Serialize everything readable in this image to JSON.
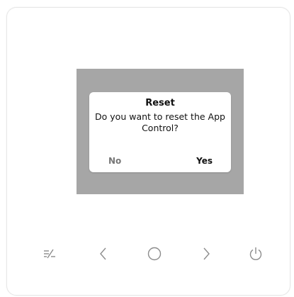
{
  "dialog": {
    "title": "Reset",
    "message": "Do you want to reset the App Control?",
    "no_label": "No",
    "yes_label": "Yes"
  },
  "buttons": [
    {
      "icon": "edit-menu-icon"
    },
    {
      "icon": "chevron-left-icon"
    },
    {
      "icon": "circle-ok-icon"
    },
    {
      "icon": "chevron-right-icon"
    },
    {
      "icon": "power-icon"
    }
  ],
  "colors": {
    "screen_bg": "#a6a6a6",
    "dialog_bg": "#ffffff",
    "icon": "#8c8c8c"
  }
}
